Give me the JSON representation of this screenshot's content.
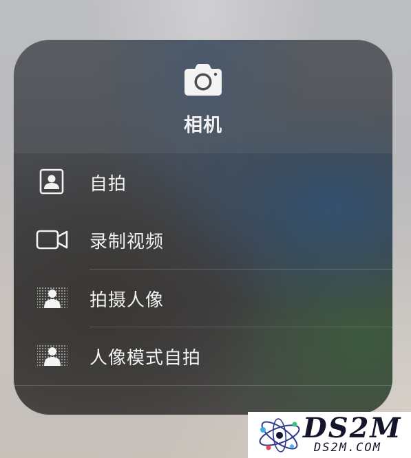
{
  "app": {
    "title": "相机",
    "icon": "camera-icon"
  },
  "actions": [
    {
      "id": "selfie",
      "label": "自拍",
      "icon": "selfie-portrait-icon"
    },
    {
      "id": "record-video",
      "label": "录制视频",
      "icon": "video-camera-icon"
    },
    {
      "id": "portrait",
      "label": "拍摄人像",
      "icon": "portrait-mode-icon"
    },
    {
      "id": "portrait-selfie",
      "label": "人像模式自拍",
      "icon": "portrait-selfie-icon"
    }
  ],
  "watermark": {
    "brand": "DS2M",
    "domain": "DS2M.COM"
  },
  "colors": {
    "menu_text": "#f1f1f1",
    "menu_background": "#45474b",
    "watermark_text": "#14142a"
  }
}
